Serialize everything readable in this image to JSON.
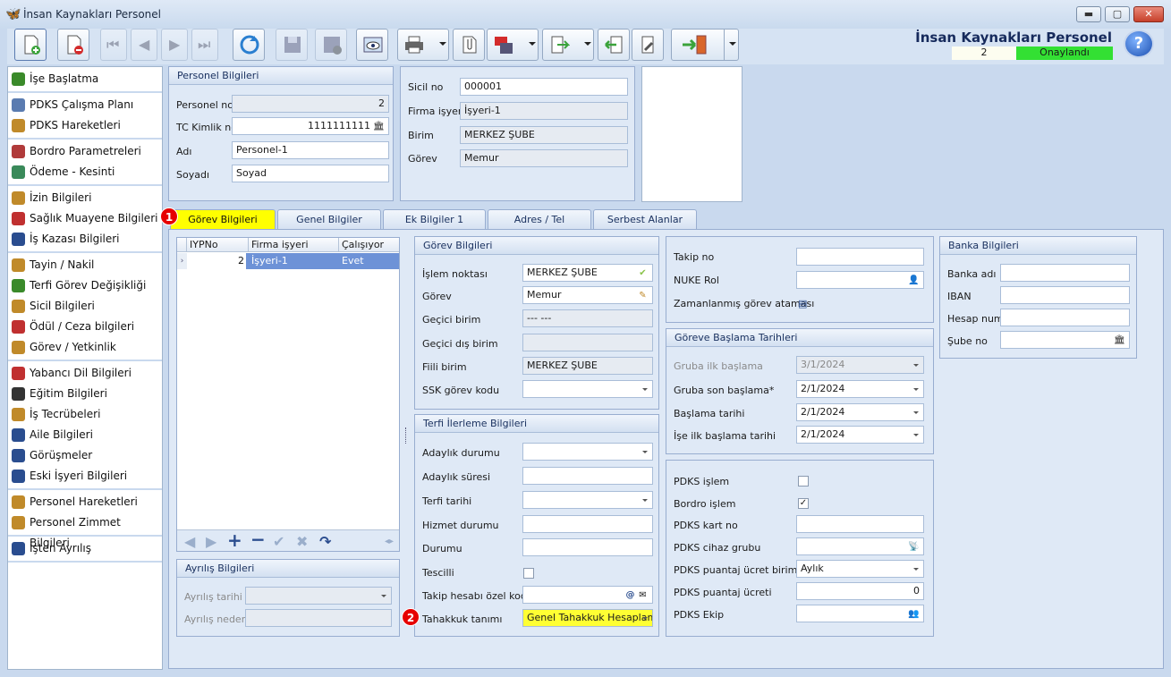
{
  "window": {
    "title": "İnsan Kaynakları Personel"
  },
  "header": {
    "title": "İnsan Kaynakları Personel",
    "record_no": "2",
    "status": "Onaylandı",
    "status_color": "#33e033",
    "help": "?"
  },
  "sidebar": [
    {
      "group": [
        {
          "label": "İşe Başlatma",
          "icon": "flag-icon",
          "color": "#3a8a2a"
        }
      ]
    },
    {
      "group": [
        {
          "label": "PDKS Çalışma Planı",
          "icon": "calendar-icon",
          "color": "#5a7bb0"
        },
        {
          "label": "PDKS Hareketleri",
          "icon": "clock-icon",
          "color": "#c08a2a"
        }
      ]
    },
    {
      "group": [
        {
          "label": "Bordro Parametreleri",
          "icon": "document-icon",
          "color": "#b03a3a"
        },
        {
          "label": "Ödeme - Kesinti",
          "icon": "money-icon",
          "color": "#3a8a5a"
        }
      ]
    },
    {
      "group": [
        {
          "label": "İzin Bilgileri",
          "icon": "person-leave-icon",
          "color": "#c08a2a"
        },
        {
          "label": "Sağlık Muayene Bilgileri",
          "icon": "health-icon",
          "color": "#c03030"
        },
        {
          "label": "İş Kazası Bilgileri",
          "icon": "accident-icon",
          "color": "#2a4d8f"
        }
      ]
    },
    {
      "group": [
        {
          "label": "Tayin / Nakil",
          "icon": "transfer-icon",
          "color": "#c08a2a"
        },
        {
          "label": "Terfi Görev Değişikliği",
          "icon": "promotion-icon",
          "color": "#3a8a2a"
        },
        {
          "label": "Sicil Bilgileri",
          "icon": "record-icon",
          "color": "#c08a2a"
        },
        {
          "label": "Ödül / Ceza bilgileri",
          "icon": "award-icon",
          "color": "#c03030"
        },
        {
          "label": "Görev / Yetkinlik",
          "icon": "task-icon",
          "color": "#c08a2a"
        }
      ]
    },
    {
      "group": [
        {
          "label": "Yabancı Dil Bilgileri",
          "icon": "language-icon",
          "color": "#c03030"
        },
        {
          "label": "Eğitim Bilgileri",
          "icon": "education-icon",
          "color": "#333333"
        },
        {
          "label": "İş Tecrübeleri",
          "icon": "experience-icon",
          "color": "#c08a2a"
        },
        {
          "label": "Aile Bilgileri",
          "icon": "family-icon",
          "color": "#2a4d8f"
        },
        {
          "label": "Görüşmeler",
          "icon": "meeting-icon",
          "color": "#2a4d8f"
        },
        {
          "label": "Eski İşyeri Bilgileri",
          "icon": "info-icon",
          "color": "#2a4d8f"
        }
      ]
    },
    {
      "group": [
        {
          "label": "Personel Hareketleri",
          "icon": "personnel-icon",
          "color": "#c08a2a"
        },
        {
          "label": "Personel Zimmet Bilgileri",
          "icon": "assets-icon",
          "color": "#c08a2a"
        }
      ]
    },
    {
      "group": [
        {
          "label": "İşten Ayrılış",
          "icon": "exit-icon",
          "color": "#2a4d8f"
        }
      ]
    }
  ],
  "personel": {
    "title": "Personel Bilgileri",
    "no_label": "Personel no",
    "no": "2",
    "tc_label": "TC Kimlik no",
    "tc": "1111111111",
    "ad_label": "Adı",
    "ad": "Personel-1",
    "soyad_label": "Soyadı",
    "soyad": "Soyad"
  },
  "sicil": {
    "sicil_label": "Sicil no",
    "sicil": "000001",
    "firma_label": "Firma işyeri",
    "firma": "İşyeri-1",
    "birim_label": "Birim",
    "birim": "MERKEZ ŞUBE",
    "gorev_label": "Görev",
    "gorev": "Memur"
  },
  "tabs": [
    "Görev Bilgileri",
    "Genel Bilgiler",
    "Ek Bilgiler 1",
    "Adres / Tel",
    "Serbest Alanlar"
  ],
  "badges": [
    "1",
    "2"
  ],
  "grid": {
    "columns": [
      "IYPNo",
      "Firma işyeri",
      "Çalışıyor"
    ],
    "rows": [
      {
        "no": "2",
        "firma": "İşyeri-1",
        "calisiyor": "Evet"
      }
    ]
  },
  "ayrilis": {
    "title": "Ayrılış Bilgileri",
    "tarih_label": "Ayrılış tarihi",
    "neden_label": "Ayrılış nedeni"
  },
  "gorev": {
    "title": "Görev Bilgileri",
    "islem_label": "İşlem noktası",
    "islem": "MERKEZ ŞUBE",
    "gorev_label": "Görev",
    "gorev": "Memur",
    "gecici_birim_label": "Geçici birim",
    "gecici_birim": "--- ---",
    "gecici_dis_label": "Geçici dış birim",
    "fiili_label": "Fiili birim",
    "fiili": "MERKEZ ŞUBE",
    "ssk_label": "SSK görev kodu"
  },
  "terfi": {
    "title": "Terfi İlerleme Bilgileri",
    "adaylik_durumu": "Adaylık durumu",
    "adaylik_suresi": "Adaylık süresi",
    "terfi_tarihi": "Terfi tarihi",
    "hizmet_durumu": "Hizmet durumu",
    "durumu": "Durumu",
    "tescilli": "Tescilli",
    "takip_ozel": "Takip hesabı özel kodu",
    "tahakkuk_label": "Tahakkuk tanımı",
    "tahakkuk": "Genel Tahakkuk Hesaplamı"
  },
  "takip": {
    "takip_label": "Takip no",
    "nuke_label": "NUKE Rol",
    "zaman_label": "Zamanlanmış görev ataması"
  },
  "baslama": {
    "title": "Göreve Başlama Tarihleri",
    "gruba_ilk_label": "Gruba ilk başlama",
    "gruba_ilk": "3/1/2024",
    "gruba_son_label": "Gruba son başlama*",
    "gruba_son": "2/1/2024",
    "baslama_label": "Başlama tarihi",
    "baslama": "2/1/2024",
    "ise_ilk_label": "İşe ilk başlama tarihi",
    "ise_ilk": "2/1/2024"
  },
  "pdks": {
    "islem_label": "PDKS işlem",
    "bordro_label": "Bordro işlem",
    "kart_label": "PDKS kart no",
    "cihaz_label": "PDKS cihaz grubu",
    "birim_label": "PDKS puantaj ücret birimi",
    "birim": "Aylık",
    "ucret_label": "PDKS puantaj ücreti",
    "ucret": "0",
    "ekip_label": "PDKS Ekip"
  },
  "banka": {
    "title": "Banka Bilgileri",
    "adi_label": "Banka adı",
    "iban_label": "IBAN",
    "hesap_label": "Hesap num",
    "sube_label": "Şube no"
  }
}
